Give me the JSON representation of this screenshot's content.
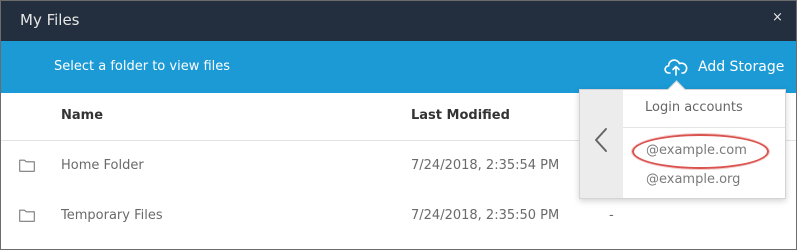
{
  "window": {
    "title": "My Files",
    "close_label": "×"
  },
  "toolbar": {
    "hint": "Select a folder to view files",
    "add_storage_label": "Add Storage"
  },
  "table": {
    "columns": [
      "Name",
      "Last Modified"
    ],
    "rows": [
      {
        "name": "Home Folder",
        "modified": "7/24/2018, 2:35:54 PM",
        "size": ""
      },
      {
        "name": "Temporary Files",
        "modified": "7/24/2018, 2:35:50 PM",
        "size": "-"
      }
    ]
  },
  "popup": {
    "heading": "Login accounts",
    "accounts": [
      "@example.com",
      "@example.org"
    ]
  },
  "colors": {
    "title_bar": "#232f3e",
    "toolbar": "#1b9ad6",
    "highlight": "#d9534f"
  }
}
